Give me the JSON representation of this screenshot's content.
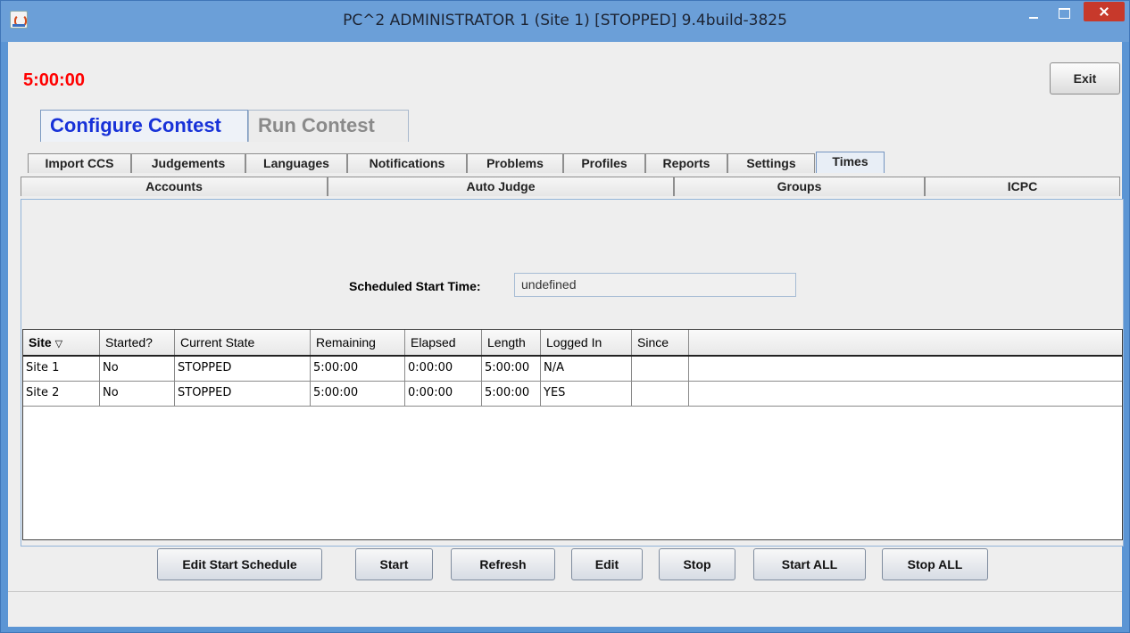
{
  "window": {
    "title": "PC^2 ADMINISTRATOR 1 (Site 1) [STOPPED] 9.4build-3825",
    "app_icon": "java-cup-icon",
    "controls": [
      "minimize-icon",
      "maximize-icon",
      "close-icon"
    ]
  },
  "clock": "5:00:00",
  "exit_label": "Exit",
  "main_tabs": [
    {
      "label": "Configure Contest",
      "active": true
    },
    {
      "label": "Run Contest",
      "active": false
    }
  ],
  "sub_tabs_row1": [
    {
      "label": "Import CCS"
    },
    {
      "label": "Judgements"
    },
    {
      "label": "Languages"
    },
    {
      "label": "Notifications"
    },
    {
      "label": "Problems"
    },
    {
      "label": "Profiles"
    },
    {
      "label": "Reports"
    },
    {
      "label": "Settings"
    },
    {
      "label": "Times",
      "active": true
    }
  ],
  "sub_tabs_row2": [
    {
      "label": "Accounts"
    },
    {
      "label": "Auto Judge"
    },
    {
      "label": "Groups"
    },
    {
      "label": "ICPC"
    }
  ],
  "scheduled_start": {
    "label": "Scheduled Start Time:",
    "value": "undefined"
  },
  "table": {
    "columns": [
      "Site",
      "Started?",
      "Current State",
      "Remaining",
      "Elapsed",
      "Length",
      "Logged In",
      "Since"
    ],
    "sort_indicator": "▽",
    "rows": [
      [
        "Site 1",
        "No",
        "STOPPED",
        "5:00:00",
        "0:00:00",
        "5:00:00",
        "N/A",
        ""
      ],
      [
        "Site 2",
        "No",
        "STOPPED",
        "5:00:00",
        "0:00:00",
        "5:00:00",
        "YES",
        ""
      ]
    ]
  },
  "buttons": {
    "edit_start_schedule": "Edit Start Schedule",
    "start": "Start",
    "refresh": "Refresh",
    "edit": "Edit",
    "stop": "Stop",
    "start_all": "Start ALL",
    "stop_all": "Stop ALL"
  },
  "colors": {
    "clock": "#ff0000",
    "active_tab_text": "#1832d8",
    "titlebar": "#6b9fd8",
    "close_button": "#c7392b"
  }
}
